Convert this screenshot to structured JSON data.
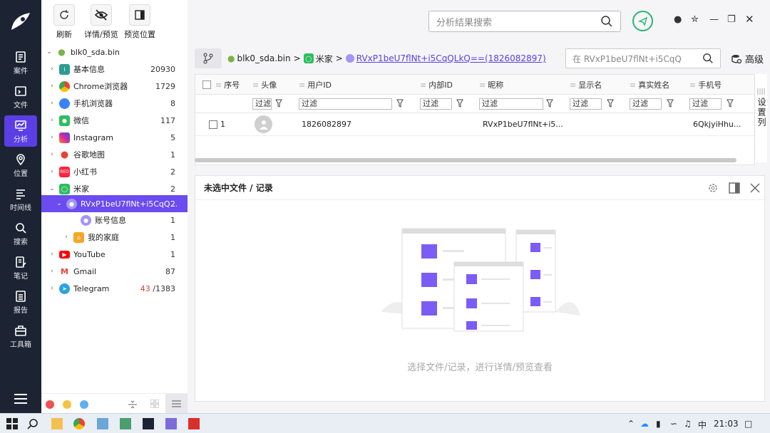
{
  "toolbar": {
    "refresh": "刷新",
    "detail_preview": "详情/预览",
    "preview_position": "预览位置"
  },
  "rail": [
    {
      "label": "案件",
      "icon": "file-text-icon"
    },
    {
      "label": "文件",
      "icon": "folder-icon"
    },
    {
      "label": "分析",
      "icon": "analysis-icon"
    },
    {
      "label": "位置",
      "icon": "location-icon"
    },
    {
      "label": "时间线",
      "icon": "timeline-icon"
    },
    {
      "label": "搜索",
      "icon": "search-icon"
    },
    {
      "label": "笔记",
      "icon": "note-icon"
    },
    {
      "label": "报告",
      "icon": "report-icon"
    },
    {
      "label": "工具箱",
      "icon": "toolbox-icon"
    }
  ],
  "tree": {
    "root": "blk0_sda.bin",
    "items": [
      {
        "label": "基本信息",
        "count": "20930",
        "color": "#2a9d8f"
      },
      {
        "label": "Chrome浏览器",
        "count": "1729",
        "color": "#e94335"
      },
      {
        "label": "手机浏览器",
        "count": "8",
        "color": "#3b82f6"
      },
      {
        "label": "微信",
        "count": "117",
        "color": "#2dbe60"
      },
      {
        "label": "Instagram",
        "count": "5",
        "color": "#d6249f"
      },
      {
        "label": "谷歌地图",
        "count": "1",
        "color": "#34a853"
      },
      {
        "label": "小红书",
        "count": "2",
        "color": "#ff2442"
      },
      {
        "label": "米家",
        "count": "2",
        "color": "#2dbe60"
      },
      {
        "label": "RVxP1beU7flNt+i5CqQ...",
        "count": "2",
        "color": "#a594f9"
      },
      {
        "label": "账号信息",
        "count": "1",
        "color": "#a594f9"
      },
      {
        "label": "我的家庭",
        "count": "1",
        "color": "#f5a623"
      },
      {
        "label": "YouTube",
        "count": "1",
        "color": "#ff0000"
      },
      {
        "label": "Gmail",
        "count": "87",
        "color": "#ea4335"
      },
      {
        "label": "Telegram",
        "count_red": "43",
        "count": "/1383",
        "color": "#2aa3e0"
      }
    ]
  },
  "search": {
    "placeholder": "分析结果搜索"
  },
  "crumbs": {
    "a": "blk0_sda.bin",
    "b": "米家",
    "c": "RVxP1beU7flNt+i5CqQLkQ==(1826082897)"
  },
  "crumb_search": {
    "placeholder": "在 RVxP1beU7flNt+i5CqQ"
  },
  "advanced": "高级",
  "grid": {
    "headers": [
      "序号",
      "头像",
      "用户ID",
      "内部ID",
      "昵称",
      "显示名",
      "真实姓名",
      "手机号"
    ],
    "filter": "过滤",
    "row": {
      "index": "1",
      "user_id": "1826082897",
      "nickname": "RVxP1beU7flNt+i5...",
      "phone": "6QkjyiHhu..."
    }
  },
  "settings_col": "设置列",
  "detail": {
    "title": "未选中文件 / 记录",
    "empty": "选择文件/记录，进行详情/预览查看"
  },
  "taskbar": {
    "time": "21:03",
    "ime": "中"
  }
}
